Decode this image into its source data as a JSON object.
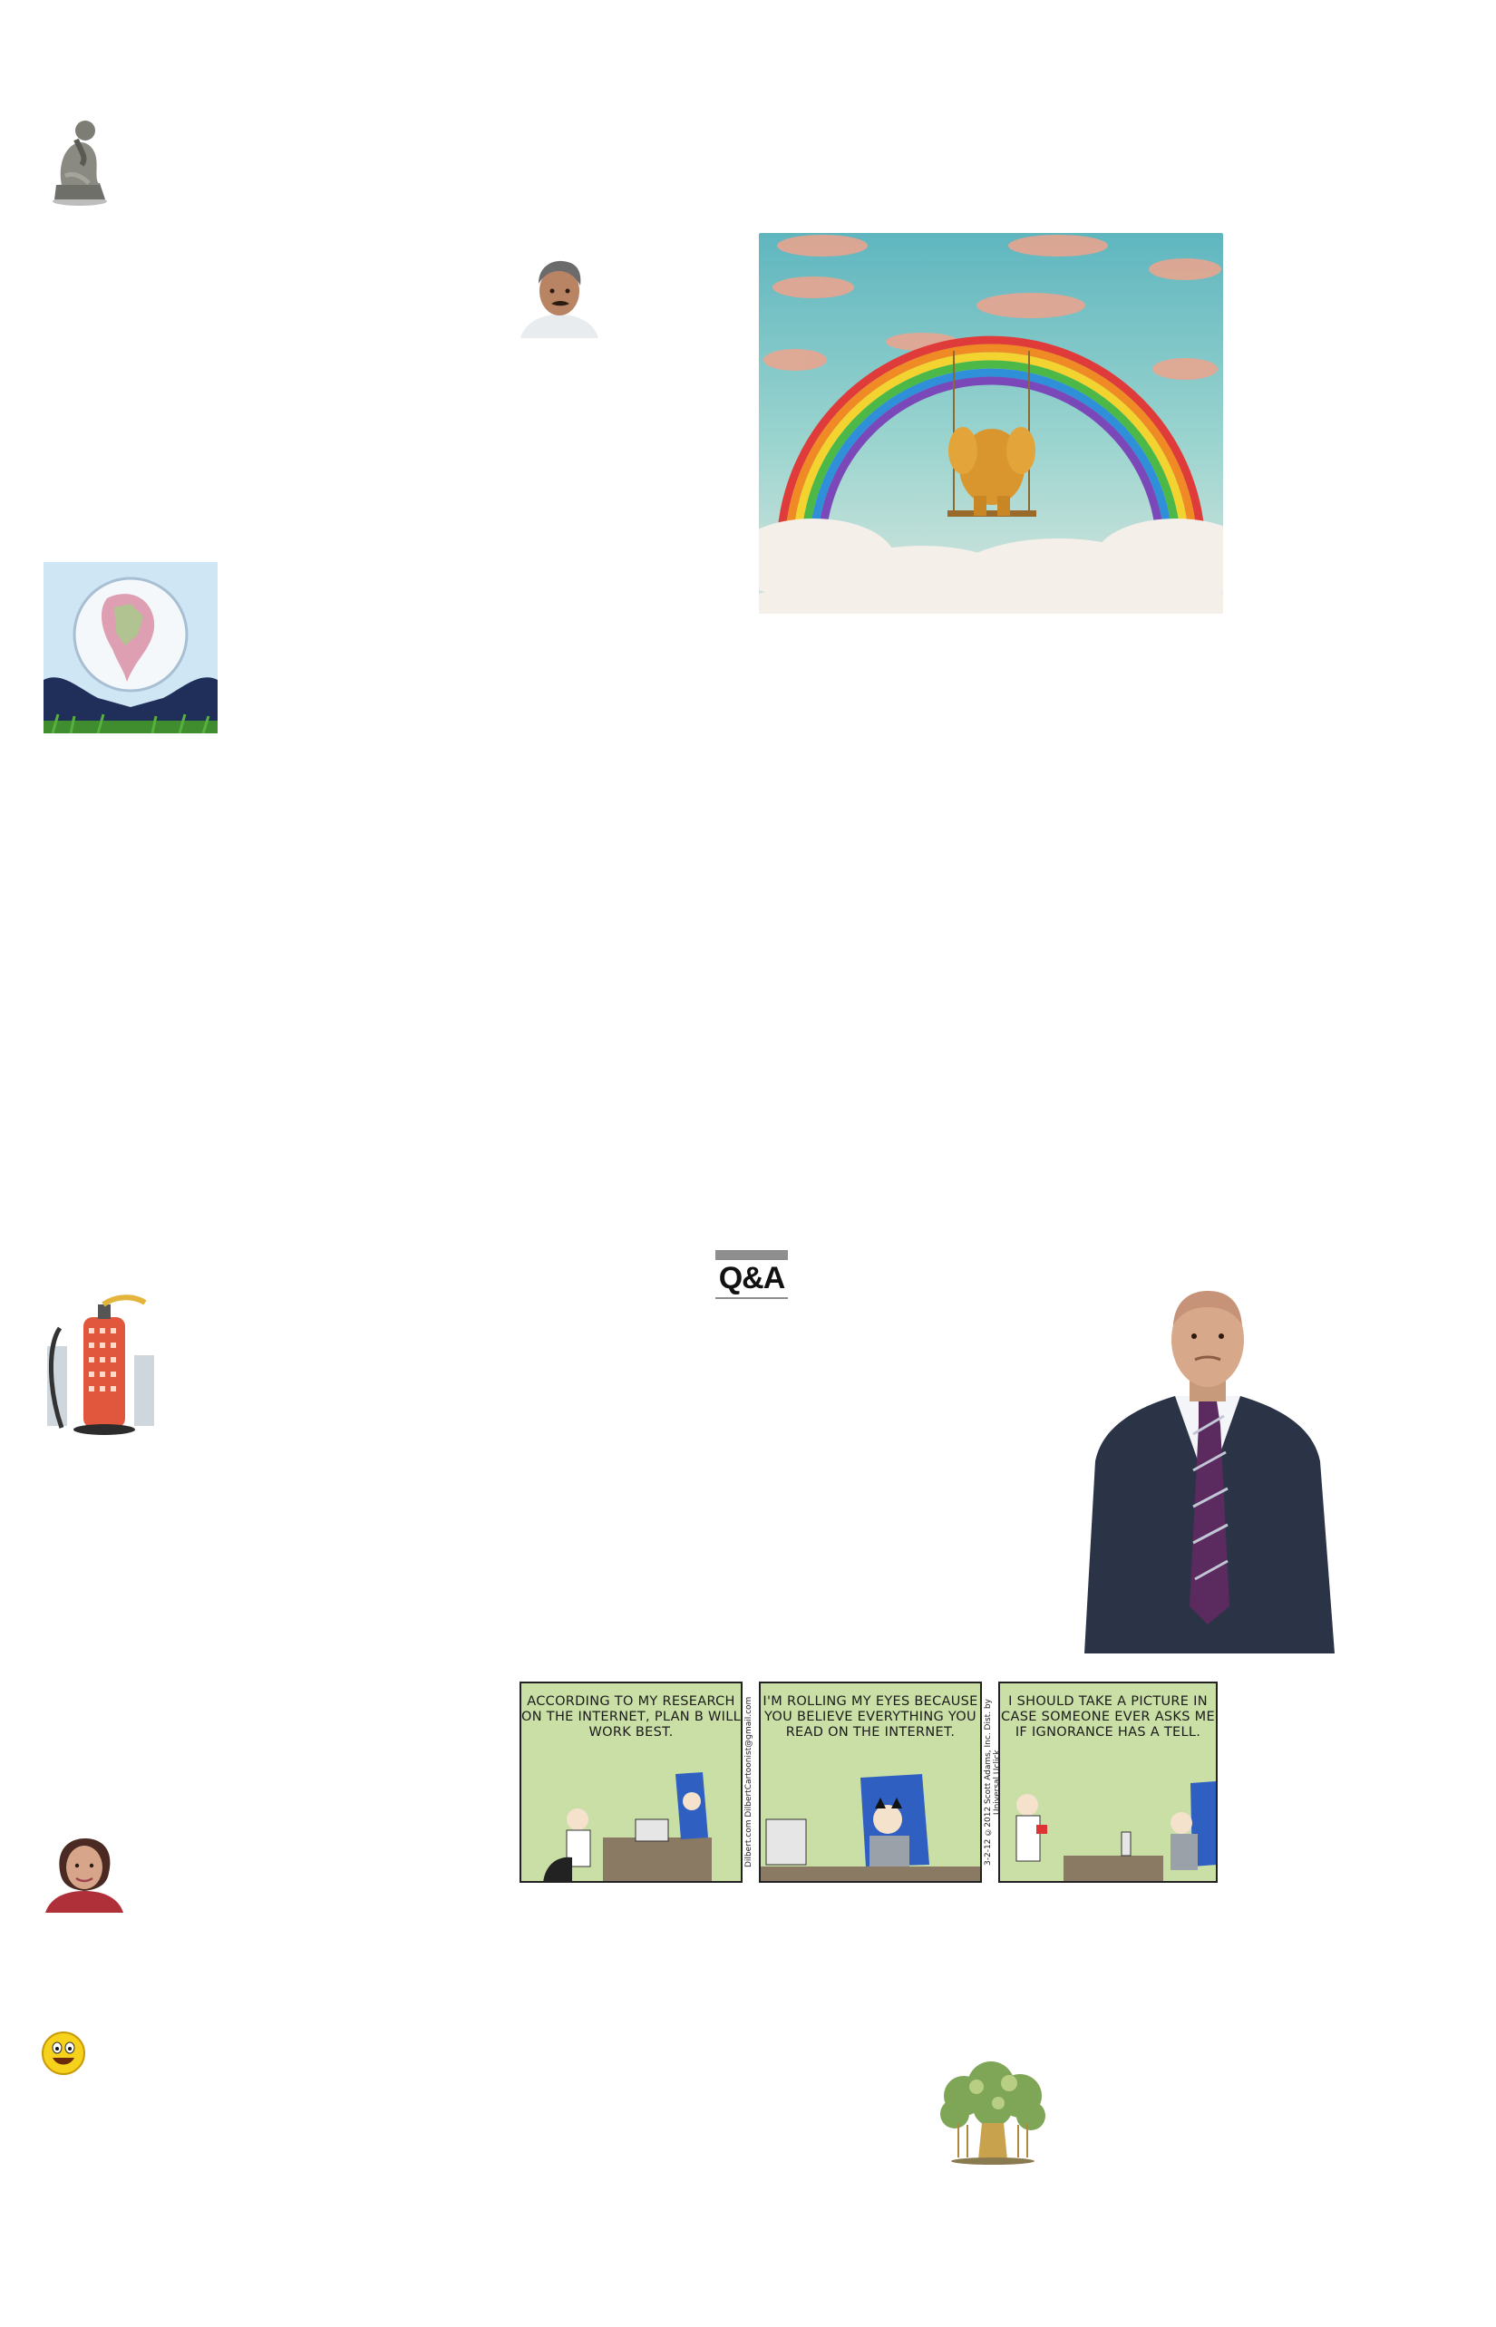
{
  "images": {
    "thinker": "thinker-statue",
    "portrait_man": "columnist-portrait",
    "rainbow": "elephant-on-rainbow-swing",
    "globe": "india-globe-in-hands",
    "extinguisher": "fire-extinguisher-building",
    "businessman": "businessman-portrait",
    "portrait_woman": "columnist-portrait",
    "smiley": "smiley-icon",
    "tree": "banyan-tree"
  },
  "qa_badge": {
    "label": "Q&A"
  },
  "comic_strip": {
    "panels": [
      {
        "speech": "ACCORDING TO MY RESEARCH ON THE INTERNET, PLAN B WILL WORK BEST."
      },
      {
        "speech": "I'M ROLLING MY EYES BECAUSE YOU BELIEVE EVERYTHING YOU READ ON THE INTERNET."
      },
      {
        "speech": "I SHOULD TAKE A PICTURE IN CASE SOMEONE EVER ASKS ME IF IGNORANCE HAS A TELL."
      }
    ],
    "side_text_1": "Dilbert.com   DilbertCartoonist@gmail.com",
    "side_text_2": "3-2-12 ©2012 Scott Adams, Inc. Dist. by Universal Uclick"
  },
  "colors": {
    "strip_bg": "#c9dfa6",
    "badge_bar": "#8e8e8e"
  }
}
